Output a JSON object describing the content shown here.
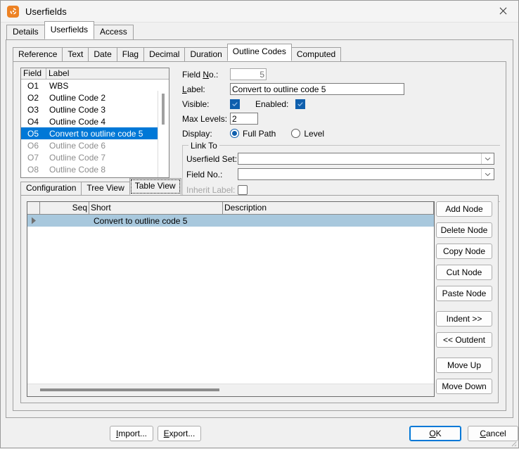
{
  "window": {
    "title": "Userfields",
    "icon": "app-swirl-icon",
    "close_label": "✕"
  },
  "outer_tabs": [
    {
      "label": "Details",
      "active": false
    },
    {
      "label": "Userfields",
      "active": true
    },
    {
      "label": "Access",
      "active": false
    }
  ],
  "inner_tabs": [
    {
      "label": "Reference",
      "active": false
    },
    {
      "label": "Text",
      "active": false
    },
    {
      "label": "Date",
      "active": false
    },
    {
      "label": "Flag",
      "active": false
    },
    {
      "label": "Decimal",
      "active": false
    },
    {
      "label": "Duration",
      "active": false
    },
    {
      "label": "Outline Codes",
      "active": true
    },
    {
      "label": "Computed",
      "active": false
    }
  ],
  "field_list": {
    "columns": [
      "Field",
      "Label"
    ],
    "rows": [
      {
        "field": "O1",
        "label": "WBS",
        "state": "normal"
      },
      {
        "field": "O2",
        "label": "Outline Code 2",
        "state": "normal"
      },
      {
        "field": "O3",
        "label": "Outline Code 3",
        "state": "normal"
      },
      {
        "field": "O4",
        "label": "Outline Code 4",
        "state": "normal"
      },
      {
        "field": "O5",
        "label": "Convert to outline code 5",
        "state": "selected"
      },
      {
        "field": "O6",
        "label": "Outline Code 6",
        "state": "disabled"
      },
      {
        "field": "O7",
        "label": "Outline Code 7",
        "state": "disabled"
      },
      {
        "field": "O8",
        "label": "Outline Code 8",
        "state": "disabled"
      }
    ]
  },
  "form": {
    "field_no_label": "Field No.:",
    "field_no_value": "5",
    "label_label": "Label:",
    "label_value": "Convert to outline code 5",
    "visible_label": "Visible:",
    "visible_checked": true,
    "enabled_label": "Enabled:",
    "enabled_checked": true,
    "max_levels_label": "Max Levels:",
    "max_levels_value": "2",
    "display_label": "Display:",
    "display_options": [
      {
        "label": "Full Path",
        "selected": true
      },
      {
        "label": "Level",
        "selected": false
      }
    ],
    "link_to": {
      "legend": "Link To",
      "userfield_set_label": "Userfield Set:",
      "userfield_set_value": "",
      "field_no_label": "Field No.:",
      "field_no_value": "",
      "inherit_label_label": "Inherit Label:",
      "inherit_label_checked": false
    }
  },
  "sub_tabs": [
    {
      "label": "Configuration",
      "active": false
    },
    {
      "label": "Tree View",
      "active": false
    },
    {
      "label": "Table View",
      "active": true
    }
  ],
  "grid": {
    "columns": [
      "",
      "Seq",
      "Short",
      "Description"
    ],
    "rows": [
      {
        "indicator": "row-arrow",
        "seq": "",
        "short": "Convert to outline code 5",
        "description": "",
        "selected": true
      }
    ]
  },
  "side_buttons": [
    {
      "label": "Add Node",
      "group": 0
    },
    {
      "label": "Delete Node",
      "group": 0
    },
    {
      "label": "Copy Node",
      "group": 0
    },
    {
      "label": "Cut Node",
      "group": 0
    },
    {
      "label": "Paste Node",
      "group": 0
    },
    {
      "label": "Indent >>",
      "group": 1
    },
    {
      "label": "<< Outdent",
      "group": 1
    },
    {
      "label": "Move Up",
      "group": 2
    },
    {
      "label": "Move Down",
      "group": 2
    }
  ],
  "footer": {
    "import_label": "Import...",
    "export_label": "Export...",
    "ok_label": "OK",
    "cancel_label": "Cancel"
  },
  "colors": {
    "accent": "#0078d7",
    "checkbox_fill": "#0f5fad",
    "row_selection": "#a8c8dd",
    "list_selection": "#0078d7",
    "app_icon": "#ed8224",
    "window_bg": "#f0f0f0"
  }
}
